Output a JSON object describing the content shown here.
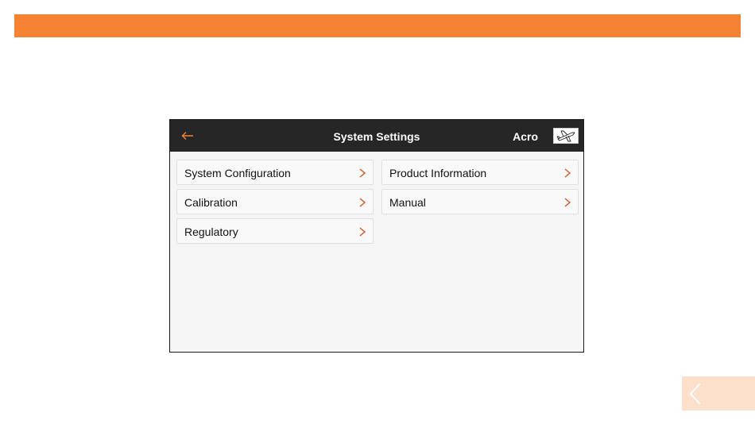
{
  "header": {
    "title": "System Settings",
    "model_name": "Acro",
    "back_icon": "arrow-left-icon",
    "model_icon": "airplane-icon"
  },
  "menu": {
    "left": [
      {
        "label": "System Configuration",
        "icon": "chevron-right-icon"
      },
      {
        "label": "Calibration",
        "icon": "chevron-right-icon"
      },
      {
        "label": "Regulatory",
        "icon": "chevron-right-icon"
      }
    ],
    "right": [
      {
        "label": "Product Information",
        "icon": "chevron-right-icon"
      },
      {
        "label": "Manual",
        "icon": "chevron-right-icon"
      }
    ]
  },
  "page_nav": {
    "prev_icon": "chevron-left-icon"
  },
  "colors": {
    "accent": "#f58233",
    "titlebar": "#262626",
    "content_bg": "#f5f5f5",
    "nav_bg": "#fde0cb"
  }
}
